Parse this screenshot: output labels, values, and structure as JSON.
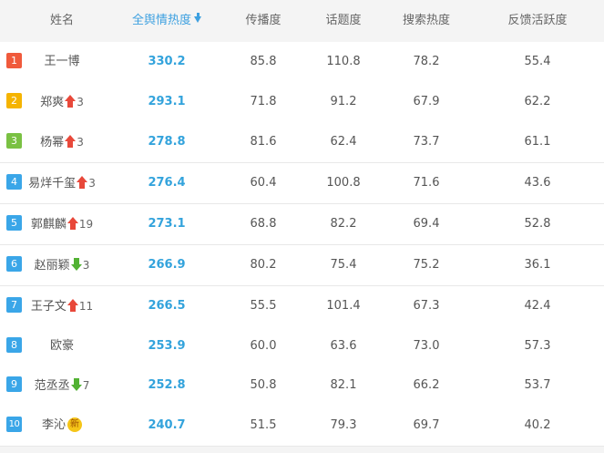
{
  "headers": {
    "name": "姓名",
    "overall": "全舆情热度",
    "spread": "传播度",
    "topic": "话题度",
    "search": "搜索热度",
    "feedback": "反馈活跃度"
  },
  "colors": {
    "rank_1": "#f05a3c",
    "rank_2": "#f5b400",
    "rank_3": "#7ac143",
    "rank_other": "#3aa6e8",
    "score": "#33a3dc",
    "up": "#e8483a",
    "down": "#52b233"
  },
  "rows": [
    {
      "rank": "1",
      "name": "王一博",
      "trend": "none",
      "change": "",
      "overall": "330.2",
      "spread": "85.8",
      "topic": "110.8",
      "search": "78.2",
      "feedback": "55.4"
    },
    {
      "rank": "2",
      "name": "郑爽",
      "trend": "up",
      "change": "3",
      "overall": "293.1",
      "spread": "71.8",
      "topic": "91.2",
      "search": "67.9",
      "feedback": "62.2"
    },
    {
      "rank": "3",
      "name": "杨幂",
      "trend": "up",
      "change": "3",
      "overall": "278.8",
      "spread": "81.6",
      "topic": "62.4",
      "search": "73.7",
      "feedback": "61.1"
    },
    {
      "rank": "4",
      "name": "易烊千玺",
      "trend": "up",
      "change": "3",
      "overall": "276.4",
      "spread": "60.4",
      "topic": "100.8",
      "search": "71.6",
      "feedback": "43.6"
    },
    {
      "rank": "5",
      "name": "郭麒麟",
      "trend": "up",
      "change": "19",
      "overall": "273.1",
      "spread": "68.8",
      "topic": "82.2",
      "search": "69.4",
      "feedback": "52.8"
    },
    {
      "rank": "6",
      "name": "赵丽颖",
      "trend": "down",
      "change": "3",
      "overall": "266.9",
      "spread": "80.2",
      "topic": "75.4",
      "search": "75.2",
      "feedback": "36.1"
    },
    {
      "rank": "7",
      "name": "王子文",
      "trend": "up",
      "change": "11",
      "overall": "266.5",
      "spread": "55.5",
      "topic": "101.4",
      "search": "67.3",
      "feedback": "42.4"
    },
    {
      "rank": "8",
      "name": "欧豪",
      "trend": "none",
      "change": "",
      "overall": "253.9",
      "spread": "60.0",
      "topic": "63.6",
      "search": "73.0",
      "feedback": "57.3"
    },
    {
      "rank": "9",
      "name": "范丞丞",
      "trend": "down",
      "change": "7",
      "overall": "252.8",
      "spread": "50.8",
      "topic": "82.1",
      "search": "66.2",
      "feedback": "53.7"
    },
    {
      "rank": "10",
      "name": "李沁",
      "trend": "new",
      "change": "新",
      "overall": "240.7",
      "spread": "51.5",
      "topic": "79.3",
      "search": "69.7",
      "feedback": "40.2"
    }
  ]
}
